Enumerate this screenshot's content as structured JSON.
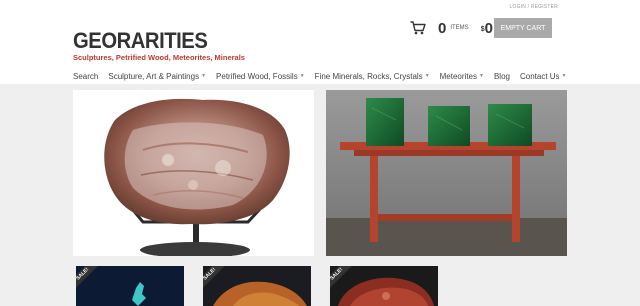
{
  "header": {
    "top_links": "LOGIN / REGISTER",
    "logo": "GEORARITIES",
    "tagline": "Sculptures, Petrified Wood, Meteorites, Minerals",
    "cart": {
      "count": "0",
      "items_label": "ITEMS",
      "currency": "$",
      "total": "0",
      "empty_cart_label": "EMPTY CART"
    }
  },
  "nav": {
    "items": [
      {
        "label": "Search",
        "has_dropdown": false
      },
      {
        "label": "Sculpture, Art & Paintings",
        "has_dropdown": true
      },
      {
        "label": "Petrified Wood, Fossils",
        "has_dropdown": true
      },
      {
        "label": "Fine Minerals, Rocks, Crystals",
        "has_dropdown": true
      },
      {
        "label": "Meteorites",
        "has_dropdown": true
      },
      {
        "label": "Blog",
        "has_dropdown": false
      },
      {
        "label": "Contact Us",
        "has_dropdown": true
      }
    ]
  },
  "products": {
    "sale_label": "SALE!"
  },
  "colors": {
    "accent_red": "#c0392b",
    "button_gray": "#aaaaaa",
    "band_gray": "#efefef"
  }
}
